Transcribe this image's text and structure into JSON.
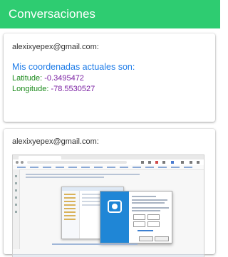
{
  "header": {
    "title": "Conversaciones"
  },
  "messages": [
    {
      "sender": "alexixyepex@gmail.com:",
      "coords_title": "Mis coordenadas actuales son:",
      "latitude_label": "Latitude:",
      "latitude_value": "-0.3495472",
      "longitude_label": "Longitude:",
      "longitude_value": "-78.5530527"
    },
    {
      "sender": "alexixyepex@gmail.com:",
      "attachment": "screenshot"
    }
  ],
  "colors": {
    "header_bg": "#2ecc71",
    "title_blue": "#1e7ce8",
    "label_green": "#1b8a1b",
    "value_purple": "#7a1fa2"
  }
}
